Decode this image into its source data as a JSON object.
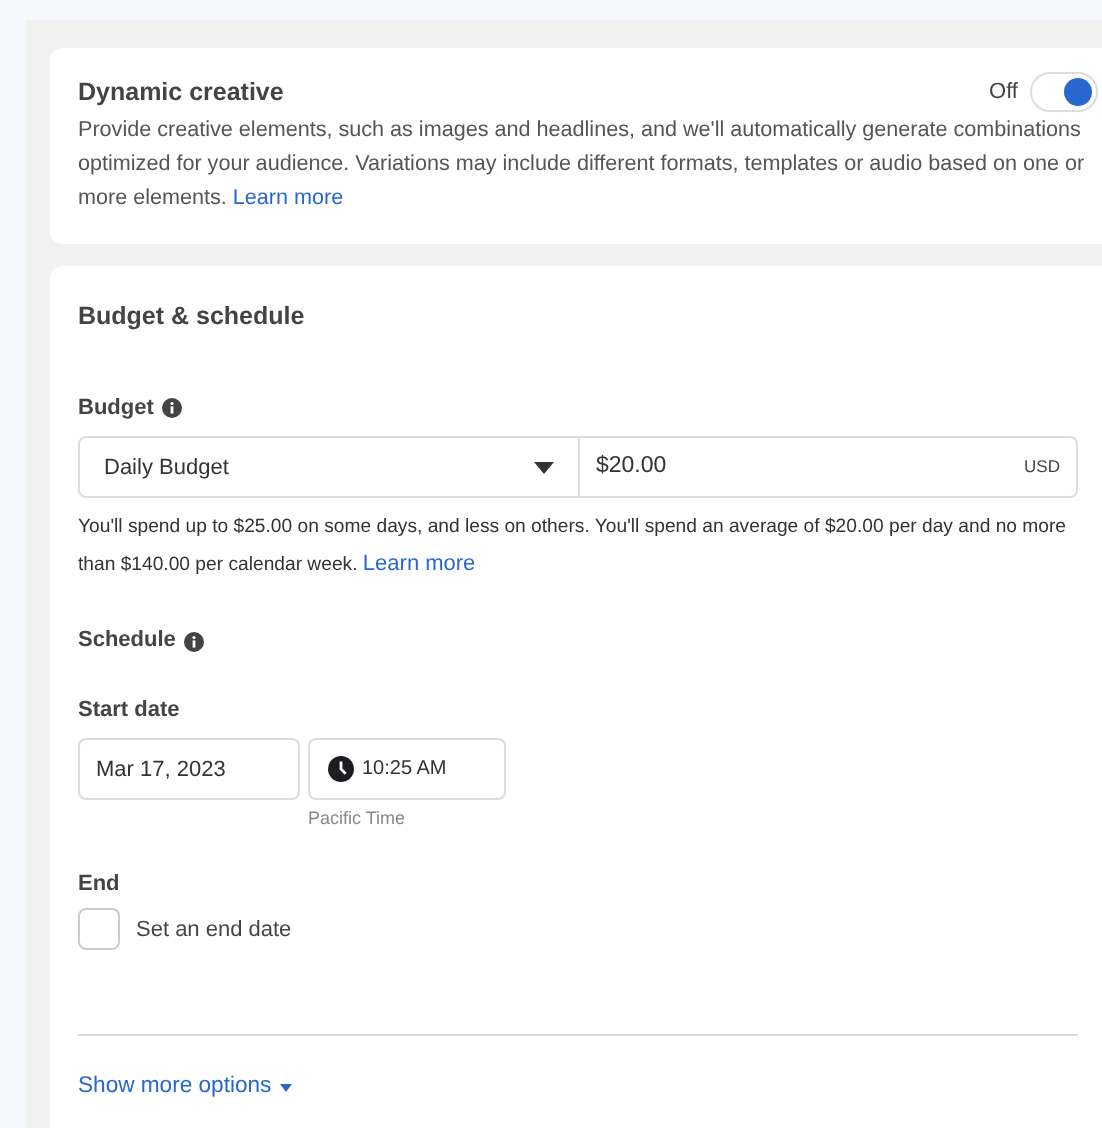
{
  "dynamic_creative": {
    "title": "Dynamic creative",
    "toggle_label": "Off",
    "on": true,
    "description": "Provide creative elements, such as images and headlines, and we'll automatically generate combinations optimized for your audience. Variations may include different formats, templates or audio based on one or more elements.",
    "link": "Learn more"
  },
  "budget_schedule": {
    "title": "Budget & schedule",
    "budget_label": "Budget",
    "budget_type": "Daily Budget",
    "amount": "$20.00",
    "currency": "USD",
    "note": "You'll spend up to $25.00 on some days, and less on others. You'll spend an average of $20.00 per day and no more than $140.00 per calendar week.",
    "note_link": "Learn more",
    "schedule_label": "Schedule",
    "start_label": "Start date",
    "start_date": "Mar 17, 2023",
    "start_time": "10:25 AM",
    "timezone": "Pacific Time",
    "end_label": "End",
    "end_checkbox": {
      "label": "Set an end date",
      "checked": false
    },
    "more_options": "Show more options"
  }
}
